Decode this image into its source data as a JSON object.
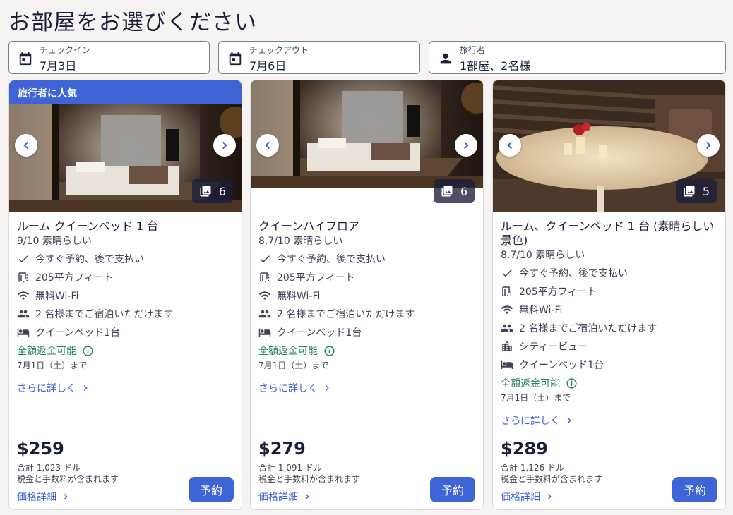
{
  "page": {
    "title": "お部屋をお選びください"
  },
  "search": {
    "checkin": {
      "label": "チェックイン",
      "value": "7月3日",
      "icon": "calendar-icon"
    },
    "checkout": {
      "label": "チェックアウト",
      "value": "7月6日",
      "icon": "calendar-icon"
    },
    "travelers": {
      "label": "旅行者",
      "value": "1部屋、2名様",
      "icon": "person-icon"
    }
  },
  "colors": {
    "accent": "#3e64d6",
    "text": "#191e3b",
    "refund": "#21825c",
    "background": "#f6f3f2"
  },
  "rooms": [
    {
      "badge": "旅行者に人気",
      "photo_count": "6",
      "photo_subject": "bedroom",
      "name": "ルーム クイーンベッド 1 台",
      "rating": "9/10 素晴らしい",
      "amenities": [
        {
          "icon": "check-icon",
          "text": "今すぐ予約、後で支払い"
        },
        {
          "icon": "area-icon",
          "text": "205平方フィート"
        },
        {
          "icon": "wifi-icon",
          "text": "無料Wi-Fi"
        },
        {
          "icon": "people-icon",
          "text": "2 名様までご宿泊いただけます"
        },
        {
          "icon": "bed-icon",
          "text": "クイーンベッド1台"
        }
      ],
      "refund": "全額返金可能",
      "refund_date": "7月1日（土）まで",
      "more_link": "さらに詳しく",
      "price": "$259",
      "total": "合計 1,023 ドル",
      "taxes": "税金と手数料が含まれます",
      "price_details": "価格詳細",
      "reserve": "予約"
    },
    {
      "badge": "",
      "photo_count": "6",
      "photo_subject": "bedroom",
      "name": "クイーンハイフロア",
      "rating": "8.7/10 素晴らしい",
      "amenities": [
        {
          "icon": "check-icon",
          "text": "今すぐ予約、後で支払い"
        },
        {
          "icon": "area-icon",
          "text": "205平方フィート"
        },
        {
          "icon": "wifi-icon",
          "text": "無料Wi-Fi"
        },
        {
          "icon": "people-icon",
          "text": "2 名様までご宿泊いただけます"
        },
        {
          "icon": "bed-icon",
          "text": "クイーンベッド1台"
        }
      ],
      "refund": "全額返金可能",
      "refund_date": "7月1日（土）まで",
      "more_link": "さらに詳しく",
      "price": "$279",
      "total": "合計 1,091 ドル",
      "taxes": "税金と手数料が含まれます",
      "price_details": "価格詳細",
      "reserve": "予約"
    },
    {
      "badge": "",
      "photo_count": "5",
      "photo_subject": "table",
      "name": "ルーム、クイーンベッド 1 台 (素晴らしい景色)",
      "rating": "8.7/10 素晴らしい",
      "amenities": [
        {
          "icon": "check-icon",
          "text": "今すぐ予約、後で支払い"
        },
        {
          "icon": "area-icon",
          "text": "205平方フィート"
        },
        {
          "icon": "wifi-icon",
          "text": "無料Wi-Fi"
        },
        {
          "icon": "people-icon",
          "text": "2 名様までご宿泊いただけます"
        },
        {
          "icon": "city-icon",
          "text": "シティービュー"
        },
        {
          "icon": "bed-icon",
          "text": "クイーンベッド1台"
        }
      ],
      "refund": "全額返金可能",
      "refund_date": "7月1日（土）まで",
      "more_link": "さらに詳しく",
      "price": "$289",
      "total": "合計 1,126 ドル",
      "taxes": "税金と手数料が含まれます",
      "price_details": "価格詳細",
      "reserve": "予約"
    }
  ]
}
